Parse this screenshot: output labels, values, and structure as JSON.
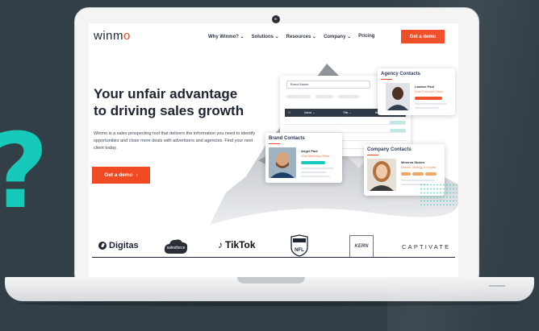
{
  "decor": {
    "question_mark": "?"
  },
  "nav": {
    "logo": "winmo",
    "links": [
      "Why Winmo? ⌄",
      "Solutions ⌄",
      "Resources ⌄",
      "Company ⌄",
      "Pricing"
    ],
    "cta": "Get a demo"
  },
  "hero": {
    "title_line1": "Your unfair advantage",
    "title_line2": "to driving sales growth",
    "description": "Winmo is a sales prospecting tool that delivers the information you need to identify opportunities and close more deals with advertisers and agencies. Find your next client today.",
    "cta": "Get a demo",
    "cta_icon": "›"
  },
  "app_mock": {
    "search_placeholder": "Brand Name",
    "columns": [
      "Name ⌄",
      "Title ⌄",
      "Bran"
    ]
  },
  "cards": {
    "agency": {
      "title": "Agency Contacts",
      "name": "Landon Paul",
      "role": "Chief Executive Officer"
    },
    "brand": {
      "title": "Brand Contacts",
      "name": "Angel Paul",
      "role": "Chief Marketing Officer"
    },
    "company": {
      "title": "Company Contacts",
      "name": "Minerva Stokes",
      "role": "Director, Strategy & Insights"
    }
  },
  "logos": {
    "digitas": "Digitas",
    "salesforce": "salesforce",
    "tiktok": "TikTok",
    "nfl": "NFL",
    "kern": "KERN",
    "captivate": "CAPTIVATE"
  },
  "colors": {
    "brand": "#f04a22",
    "accent": "#17c9b8",
    "background": "#323f47",
    "navy": "#1d2533"
  }
}
